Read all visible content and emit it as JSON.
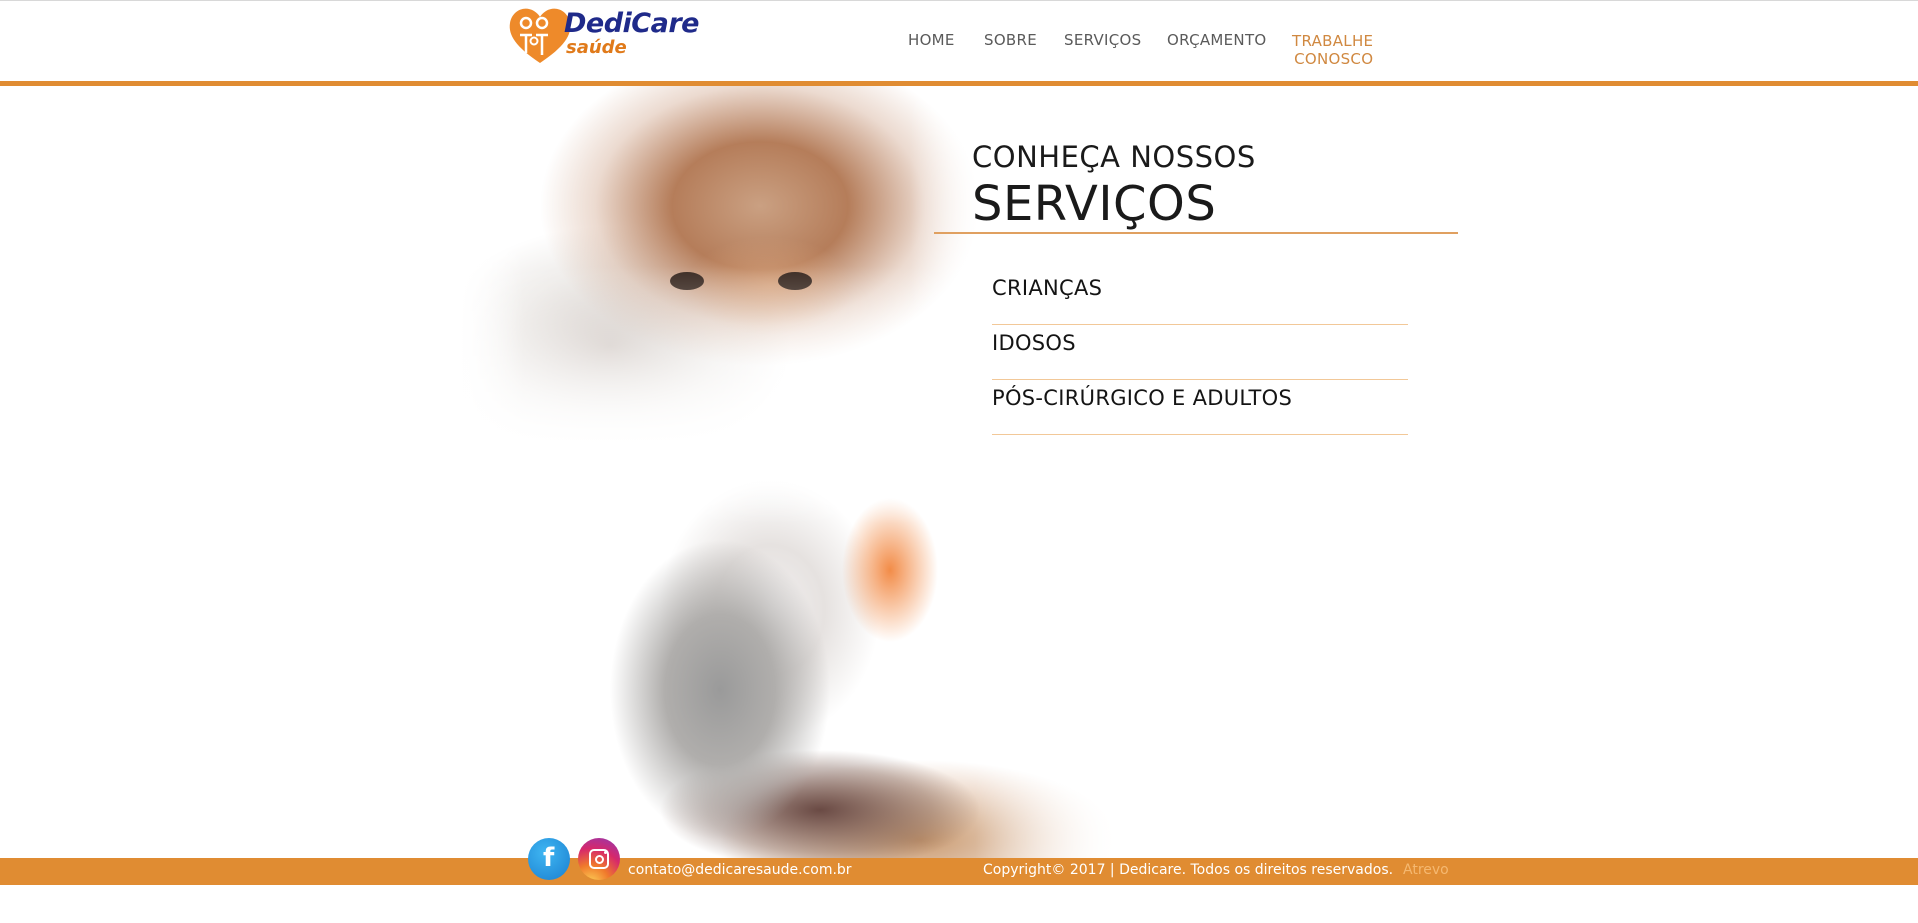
{
  "brand": {
    "name": "DediCare",
    "tagline": "saúde",
    "primary_color": "#1f2a8a",
    "accent_color": "#e08c32"
  },
  "nav": {
    "items": [
      {
        "label": "HOME"
      },
      {
        "label": "SOBRE"
      },
      {
        "label": "SERVIÇOS"
      },
      {
        "label": "ORÇAMENTO"
      },
      {
        "label": "TRABALHE",
        "label2": "CONOSCO"
      }
    ]
  },
  "hero": {
    "eyebrow": "CONHEÇA NOSSOS",
    "title": "SERVIÇOS",
    "images": [
      "child-photo",
      "caregiver-elderly-photo"
    ]
  },
  "services": [
    {
      "label": "CRIANÇAS"
    },
    {
      "label": "IDOSOS"
    },
    {
      "label": "PÓS-CIRÚRGICO E ADULTOS"
    }
  ],
  "footer": {
    "social": [
      {
        "icon": "facebook-icon"
      },
      {
        "icon": "instagram-icon"
      }
    ],
    "contact_email": "contato@dedicaresaude.com.br",
    "copyright": "Copyright© 2017 | Dedicare. Todos os direitos reservados.",
    "credit": "Atrevo"
  }
}
